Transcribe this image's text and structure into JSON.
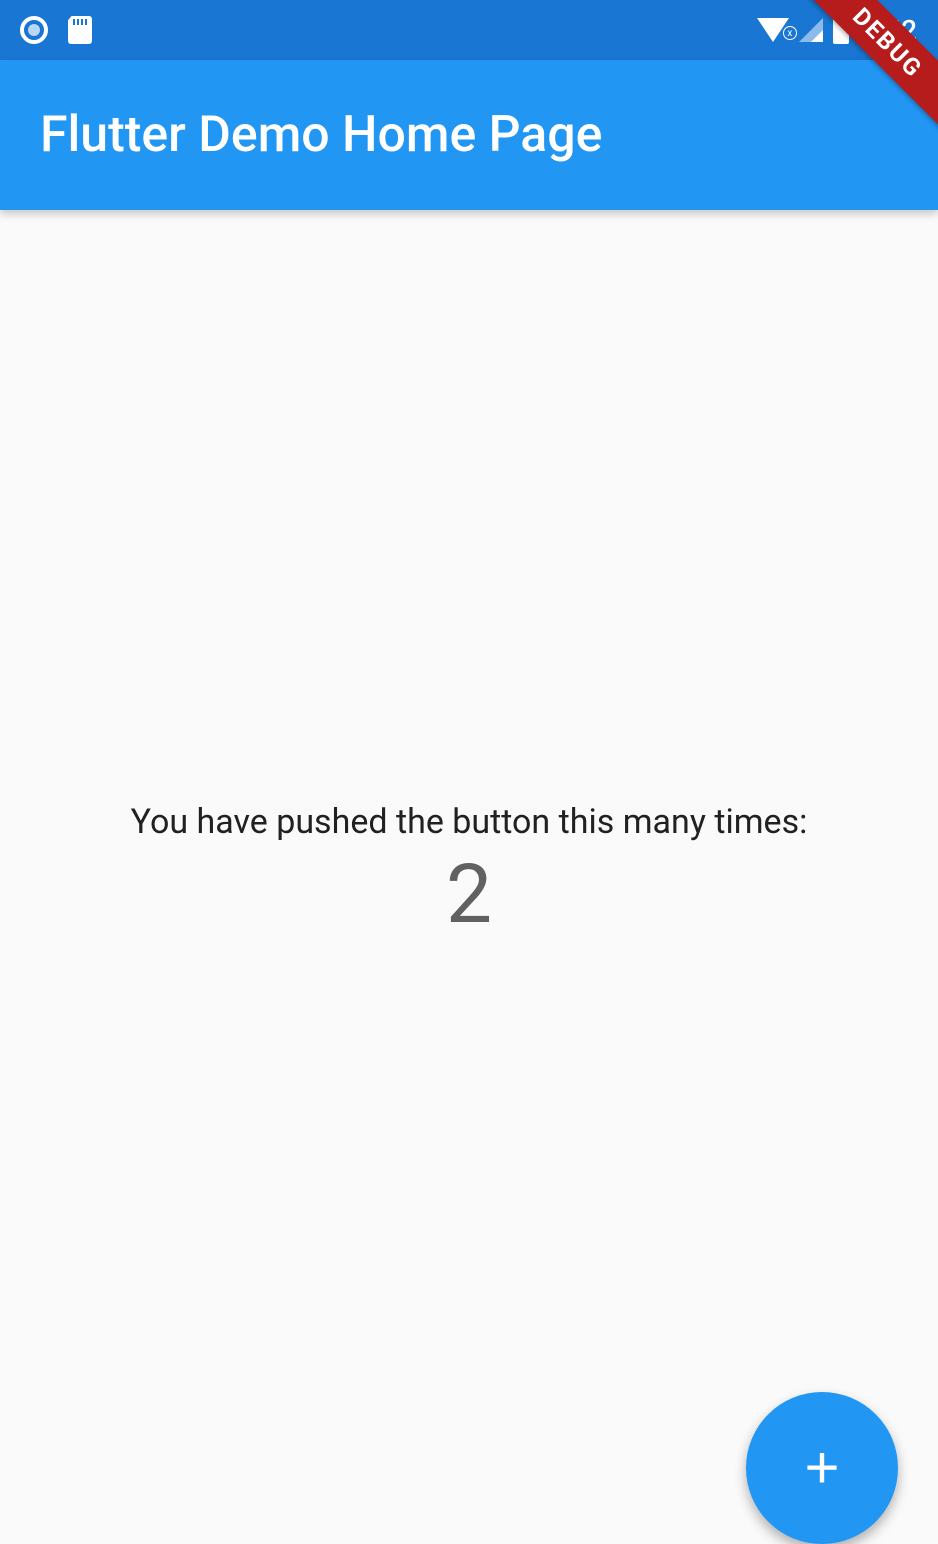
{
  "status_bar": {
    "time": "8:52",
    "wifi_indicator": "x"
  },
  "app_bar": {
    "title": "Flutter Demo Home Page"
  },
  "debug_banner": {
    "label": "DEBUG"
  },
  "body": {
    "counter_label": "You have pushed the button this many times:",
    "counter_value": "2"
  },
  "fab": {
    "icon": "+"
  },
  "colors": {
    "primary": "#2196F3",
    "primary_dark": "#1976D2",
    "debug_red": "#B71C1C",
    "background": "#fafafa"
  }
}
